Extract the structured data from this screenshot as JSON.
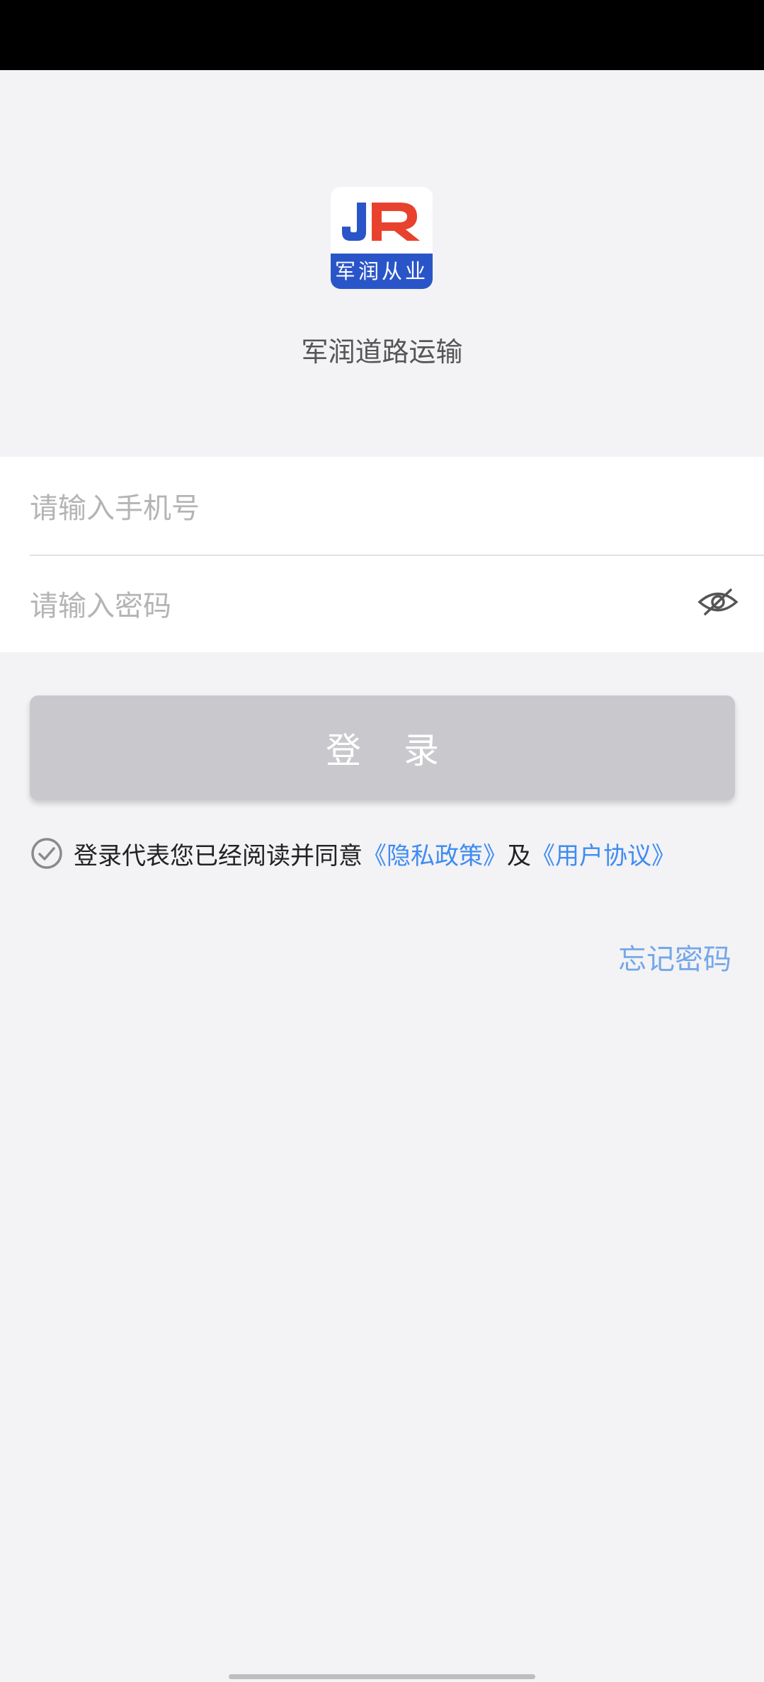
{
  "logo": {
    "lettering": "军润从业",
    "mark": "JR"
  },
  "app": {
    "name": "军润道路运输"
  },
  "form": {
    "phone_placeholder": "请输入手机号",
    "phone_value": "",
    "password_placeholder": "请输入密码",
    "password_value": "",
    "password_visibility_icon": "eye-slash-icon"
  },
  "login": {
    "label": "登录"
  },
  "agreement": {
    "checkbox_icon": "check-circle-icon",
    "text": "登录代表您已经阅读并同意",
    "privacy_link": "《隐私政策》",
    "conjunction": "及",
    "terms_link": "《用户协议》"
  },
  "forgot_password": {
    "label": "忘记密码"
  },
  "colors": {
    "link": "#3f8cf0",
    "logo_blue": "#2a55c9",
    "logo_red": "#e8422f",
    "button_disabled": "#c9c8cc",
    "background": "#f3f2f5"
  }
}
